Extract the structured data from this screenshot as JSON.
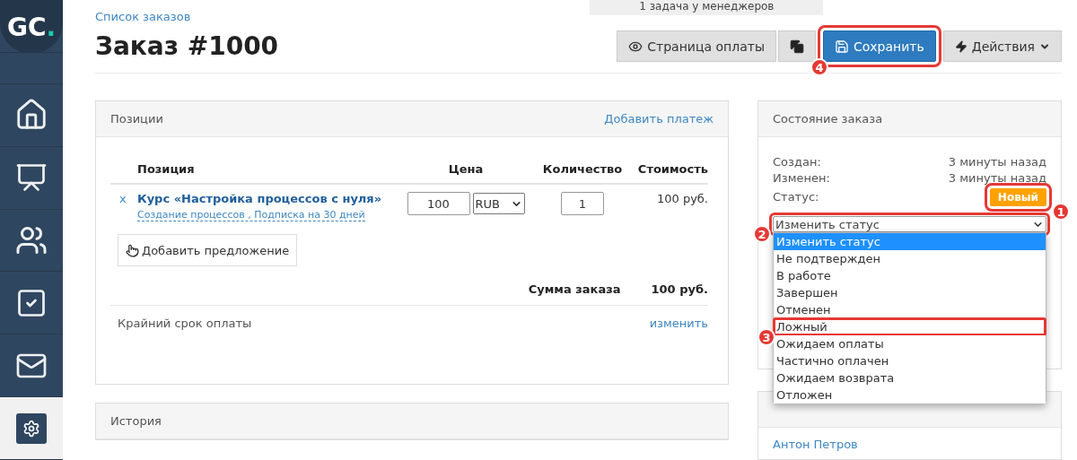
{
  "logo": {
    "text": "GC",
    "accent": "."
  },
  "top_tab": {
    "label": "1 задача у менеджеров"
  },
  "breadcrumb": "Список заказов",
  "title": "Заказ #1000",
  "toolbar": [
    {
      "kind": "button",
      "label": "Страница оплаты"
    },
    {
      "kind": "icon"
    },
    {
      "kind": "primary",
      "label": "Сохранить",
      "callout": "4"
    },
    {
      "kind": "dropdown",
      "label": "Действия"
    }
  ],
  "positions": {
    "title": "Позиции",
    "action": "Добавить платеж",
    "columns": [
      "Позиция",
      "Цена",
      "Количество",
      "Стоимость"
    ],
    "rows": [
      {
        "remove": "x",
        "name": "Курс «Настройка процессов с нуля»",
        "details": "Создание процессов , Подписка на 30 дней",
        "price": "100",
        "currency": "RUB",
        "quantity": "1",
        "cost": "100 руб."
      }
    ],
    "add_offer": "Добавить предложение",
    "total_label": "Сумма заказа",
    "total": "100 руб.",
    "deadline_label": "Крайний срок оплаты",
    "deadline_action": "изменить"
  },
  "history": {
    "title": "История"
  },
  "order_state": {
    "title": "Состояние заказа",
    "fields": [
      {
        "label": "Создан:",
        "value": "3 минуты назад"
      },
      {
        "label": "Изменен:",
        "value": "3 минуты назад"
      }
    ],
    "status_label": "Статус:",
    "status": {
      "label": "Новый",
      "color": "#ffa200",
      "callout": "1"
    },
    "select": {
      "value": "Изменить статус",
      "callout": "2"
    },
    "options": [
      {
        "label": "Изменить статус",
        "selected": true
      },
      {
        "label": "Не подтвержден",
        "selected": false
      },
      {
        "label": "В работе",
        "selected": false
      },
      {
        "label": "Завершен",
        "selected": false
      },
      {
        "label": "Отменен",
        "selected": false
      },
      {
        "label": "Ложный",
        "selected": false,
        "callout": "3"
      },
      {
        "label": "Ожидаем оплаты",
        "selected": false
      },
      {
        "label": "Частично оплачен",
        "selected": false
      },
      {
        "label": "Ожидаем возврата",
        "selected": false
      },
      {
        "label": "Отложен",
        "selected": false
      }
    ]
  },
  "manager_card": {
    "name": "Антон Петров"
  }
}
